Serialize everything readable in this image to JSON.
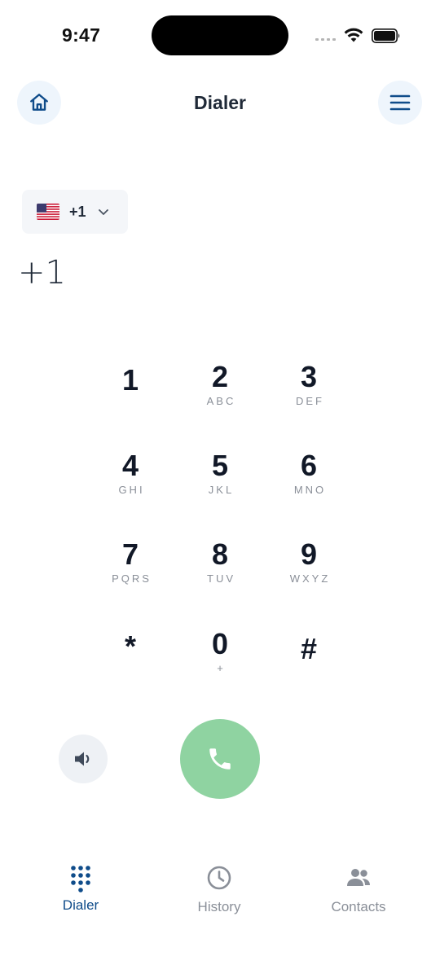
{
  "status_bar": {
    "time": "9:47"
  },
  "header": {
    "title": "Dialer",
    "home_icon": "home-icon",
    "menu_icon": "hamburger-menu-icon"
  },
  "country_selector": {
    "flag": "us-flag",
    "code": "+1"
  },
  "number_display": "+1",
  "keypad": [
    {
      "digit": "1",
      "letters": ""
    },
    {
      "digit": "2",
      "letters": "ABC"
    },
    {
      "digit": "3",
      "letters": "DEF"
    },
    {
      "digit": "4",
      "letters": "GHI"
    },
    {
      "digit": "5",
      "letters": "JKL"
    },
    {
      "digit": "6",
      "letters": "MNO"
    },
    {
      "digit": "7",
      "letters": "PQRS"
    },
    {
      "digit": "8",
      "letters": "TUV"
    },
    {
      "digit": "9",
      "letters": "WXYZ"
    },
    {
      "digit": "*",
      "letters": ""
    },
    {
      "digit": "0",
      "letters": "+"
    },
    {
      "digit": "#",
      "letters": ""
    }
  ],
  "controls": {
    "speaker_icon": "speaker-icon",
    "call_icon": "phone-icon"
  },
  "tabs": [
    {
      "label": "Dialer",
      "icon": "keypad-icon",
      "active": true
    },
    {
      "label": "History",
      "icon": "clock-icon",
      "active": false
    },
    {
      "label": "Contacts",
      "icon": "people-icon",
      "active": false
    }
  ],
  "colors": {
    "accent": "#0f4c8a",
    "call_green": "#8fd3a1",
    "button_bg": "#eef5fc",
    "inactive_tab": "#8a8f98"
  }
}
